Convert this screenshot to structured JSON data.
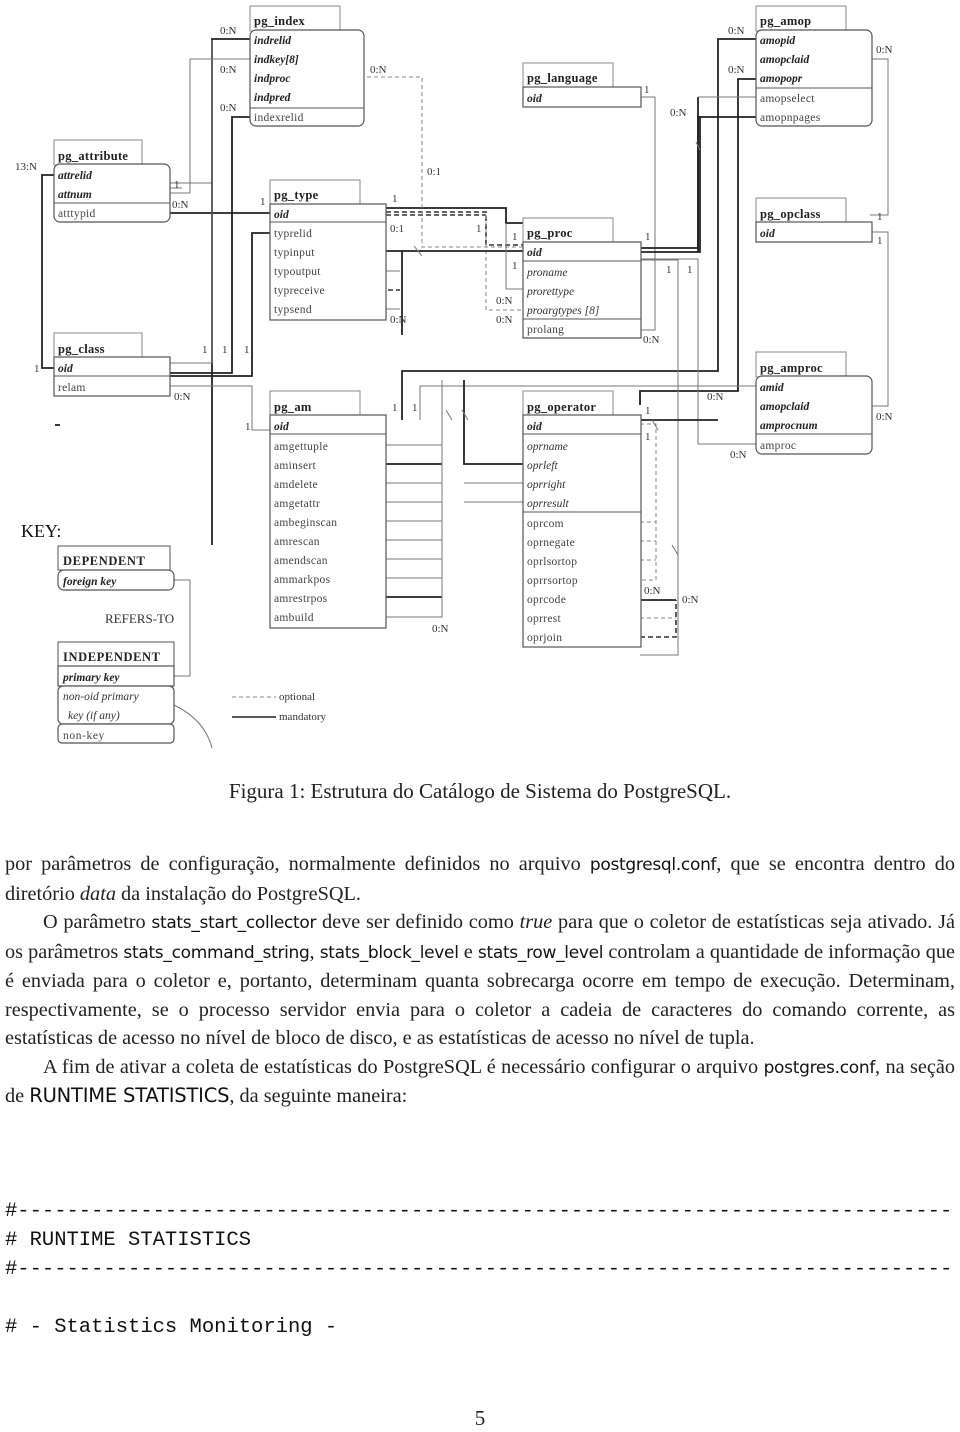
{
  "figure": {
    "tables": {
      "pg_index": {
        "name": "pg_index",
        "keys": [
          "indrelid",
          "indkey[8]",
          "indproc",
          "indpred"
        ],
        "fields": [
          "indexrelid"
        ]
      },
      "pg_amop": {
        "name": "pg_amop",
        "keys": [
          "amopid",
          "amopclaid",
          "amopopr"
        ],
        "fields": [
          "amopselect",
          "amopnpages"
        ]
      },
      "pg_language": {
        "name": "pg_language",
        "keys": [
          "oid"
        ],
        "fields": []
      },
      "pg_attribute": {
        "name": "pg_attribute",
        "keys": [
          "attrelid",
          "attnum"
        ],
        "fields": [
          "atttypid"
        ]
      },
      "pg_type": {
        "name": "pg_type",
        "keys": [
          "oid"
        ],
        "fields": [
          "typrelid",
          "typinput",
          "typoutput",
          "typreceive",
          "typsend"
        ]
      },
      "pg_proc": {
        "name": "pg_proc",
        "keys": [
          "oid"
        ],
        "italic_fields": [
          "proname",
          "prorettype",
          "proargtypes [8]"
        ],
        "fields": [
          "prolang"
        ]
      },
      "pg_opclass": {
        "name": "pg_opclass",
        "keys": [
          "oid"
        ],
        "fields": []
      },
      "pg_class": {
        "name": "pg_class",
        "keys": [
          "oid"
        ],
        "fields": [
          "relam"
        ]
      },
      "pg_amproc": {
        "name": "pg_amproc",
        "keys": [
          "amid",
          "amopclaid",
          "amprocnum"
        ],
        "fields": [
          "amproc"
        ]
      },
      "pg_am": {
        "name": "pg_am",
        "keys": [
          "oid"
        ],
        "fields": [
          "amgettuple",
          "aminsert",
          "amdelete",
          "amgetattr",
          "ambeginscan",
          "amrescan",
          "amendscan",
          "ammarkpos",
          "amrestrpos",
          "ambuild"
        ]
      },
      "pg_operator": {
        "name": "pg_operator",
        "keys": [
          "oid"
        ],
        "italic_fields": [
          "oprname",
          "oprleft",
          "oprright",
          "oprresult"
        ],
        "fields": [
          "oprcom",
          "oprnegate",
          "oprlsortop",
          "oprrsortop",
          "oprcode",
          "oprrest",
          "oprjoin"
        ]
      }
    },
    "cardinalities": {
      "c0N": "0:N",
      "c01": "0:1",
      "c1": "1",
      "c13N": "13:N"
    },
    "key": {
      "title": "KEY:",
      "dependent": "DEPENDENT",
      "foreign_key": "foreign key",
      "refers_to": "REFERS-TO",
      "independent": "INDEPENDENT",
      "primary_key": "primary key",
      "non_oid_1": "non-oid primary",
      "non_oid_2": "key (if any)",
      "non_key": "non-key",
      "optional": "optional",
      "mandatory": "mandatory"
    },
    "caption": "Figura 1: Estrutura do Catálogo de Sistema do PostgreSQL."
  },
  "body": {
    "p1": {
      "a": "por parâmetros de configuração, normalmente definidos no arquivo ",
      "file": "postgresql.conf",
      "b": ", que se encontra dentro do diretório ",
      "dir": "data",
      "c": " da instalação do PostgreSQL."
    },
    "p2": {
      "a": "O parâmetro ",
      "param1": "stats_start_collector",
      "b": " deve ser definido como ",
      "val": "true",
      "c": " para que o coletor de estatísticas seja ativado. Já os parâmetros ",
      "param2": "stats_command_string",
      "d": ", ",
      "param3": "stats_block_level",
      "e": " e ",
      "param4": "stats_row_level",
      "f": " controlam a quantidade de informação que é enviada para o coletor e, portanto, determinam quanta sobrecarga ocorre em tempo de execução. Determinam, respectivamente, se o processo servidor envia para o coletor a cadeia de caracteres do comando corrente, as estatísticas de acesso no nível de bloco de disco, e as estatísticas de acesso no nível de tupla."
    },
    "p3": {
      "a": "A fim de ativar a coleta de estatísticas do PostgreSQL é necessário configurar o arquivo ",
      "file": "postgres.conf",
      "b": ", na seção de ",
      "section": "RUNTIME STATISTICS",
      "c": ", da seguinte maneira:"
    }
  },
  "code": [
    "#----------------------------------------------------------------------------",
    "# RUNTIME STATISTICS",
    "#----------------------------------------------------------------------------",
    "",
    "# - Statistics Monitoring -"
  ],
  "page_number": "5"
}
